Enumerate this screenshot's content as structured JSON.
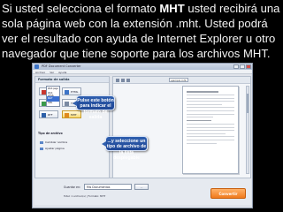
{
  "caption": {
    "part1": "Si usted selecciona el formato ",
    "bold": "MHT",
    "part2": " usted recibirá una sola página web con la extensión .mht. Usted podrá ver el resultado con ayuda de Internet Explorer u otro navegador que tiene soporte para los archivos MHT."
  },
  "window": {
    "title": "PDF Document Converter",
    "menu": [
      "Archivo",
      "Ver",
      "Ayuda"
    ]
  },
  "left_panel": {
    "header": "Formato de salida",
    "formats": [
      "PDF",
      "HTML",
      "Imagen",
      "TXT",
      "RTF",
      "MHT"
    ],
    "section_label": "Tipo de archivo",
    "options": [
      "Cambiar nombre",
      "Ajustar página"
    ]
  },
  "dropdown": {
    "items": [
      "Web page",
      "Web HTML",
      "MHT",
      "XML"
    ],
    "selected_index": 2
  },
  "preview": {
    "address": "ejemplo.mht"
  },
  "bottom": {
    "output_label": "Guardar en:",
    "output_value": "Mis Documentos",
    "browse_label": "...",
    "status": "Total: 1 archivo(s) | Formato: MHT",
    "convert_label": "Convertir"
  },
  "callouts": {
    "first": "Pulse este botón para indicar el formato de salida",
    "second": "...y seleccione un tipo de archivo de la lista desplegable"
  },
  "colors": {
    "background": "#000000",
    "caption_text": "#f2f2f2",
    "callout_fill": "#2f5fae",
    "selected_format": "#f6d970",
    "convert_button": "#f07a1c"
  }
}
